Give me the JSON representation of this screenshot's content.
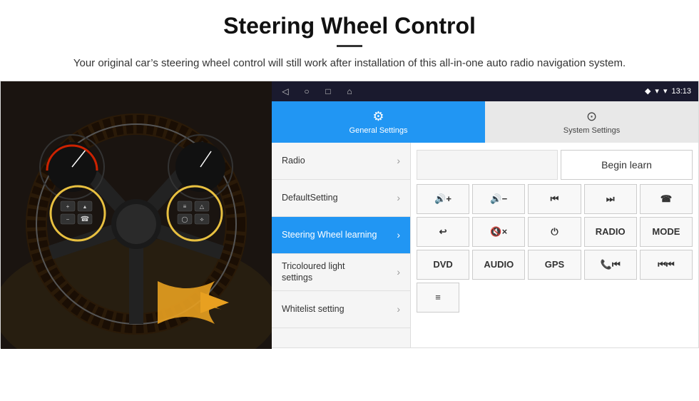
{
  "header": {
    "title": "Steering Wheel Control",
    "divider": true,
    "subtitle": "Your original car’s steering wheel control will still work after installation of this all-in-one auto radio navigation system."
  },
  "statusBar": {
    "navItems": [
      "◁",
      "○",
      "□",
      "⌂"
    ],
    "rightItems": [
      "♦",
      "▾",
      "▾",
      "13:13"
    ]
  },
  "tabs": [
    {
      "id": "general",
      "label": "General Settings",
      "icon": "⚙",
      "active": true
    },
    {
      "id": "system",
      "label": "System Settings",
      "icon": "⌖",
      "active": false
    }
  ],
  "menu": {
    "items": [
      {
        "label": "Radio",
        "active": false
      },
      {
        "label": "DefaultSetting",
        "active": false
      },
      {
        "label": "Steering Wheel learning",
        "active": true
      },
      {
        "label": "Tricoloured light settings",
        "active": false
      },
      {
        "label": "Whitelist setting",
        "active": false
      }
    ]
  },
  "rightPanel": {
    "beginLearnLabel": "Begin learn",
    "buttonRows": [
      [
        {
          "label": "🔊+",
          "id": "vol-up"
        },
        {
          "label": "🔊−",
          "id": "vol-down"
        },
        {
          "label": "⏮",
          "id": "prev-track"
        },
        {
          "label": "⏭",
          "id": "next-track"
        },
        {
          "label": "☎",
          "id": "phone"
        }
      ],
      [
        {
          "label": "↩",
          "id": "hang-up"
        },
        {
          "label": "🔇×",
          "id": "mute"
        },
        {
          "label": "⏻",
          "id": "power"
        },
        {
          "label": "RADIO",
          "id": "radio"
        },
        {
          "label": "MODE",
          "id": "mode"
        }
      ],
      [
        {
          "label": "DVD",
          "id": "dvd"
        },
        {
          "label": "AUDIO",
          "id": "audio"
        },
        {
          "label": "GPS",
          "id": "gps"
        },
        {
          "label": "📞⏮",
          "id": "tel-prev"
        },
        {
          "label": "⏮⏮",
          "id": "rwd"
        }
      ]
    ],
    "whitelistIcon": "≡"
  }
}
